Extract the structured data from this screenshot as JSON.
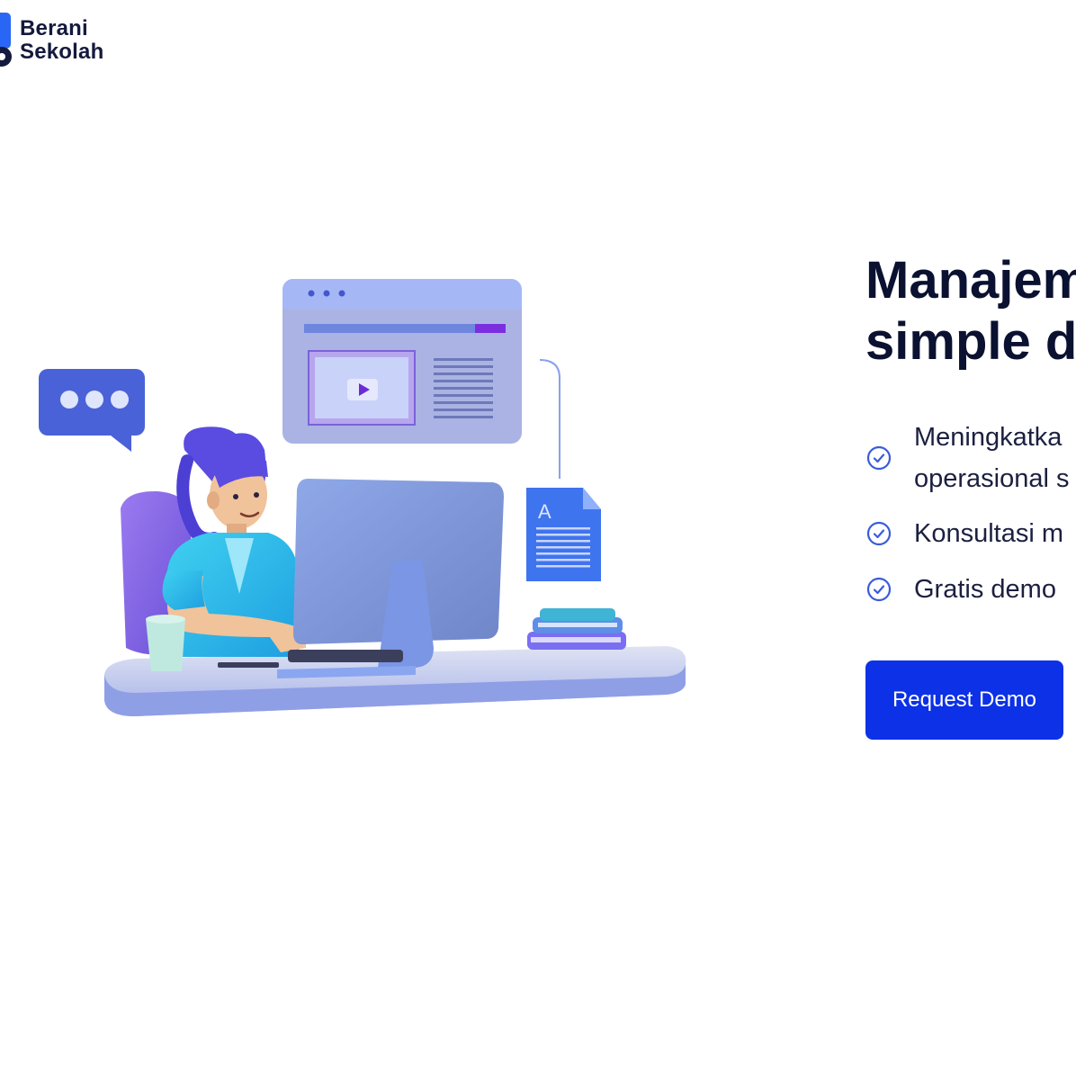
{
  "brand": {
    "line1": "Berani",
    "line2": "Sekolah"
  },
  "hero": {
    "headline_line1": "Manajem",
    "headline_line2": "simple d",
    "features": [
      {
        "label": "Meningkatka",
        "label_line2": "operasional s"
      },
      {
        "label": "Konsultasi m"
      },
      {
        "label": "Gratis demo"
      }
    ],
    "cta_label": "Request Demo"
  },
  "illustration": {
    "doc_letter": "A"
  },
  "colors": {
    "accent": "#0c31e6",
    "text_dark": "#0b1130",
    "check": "#3b5bdb"
  }
}
